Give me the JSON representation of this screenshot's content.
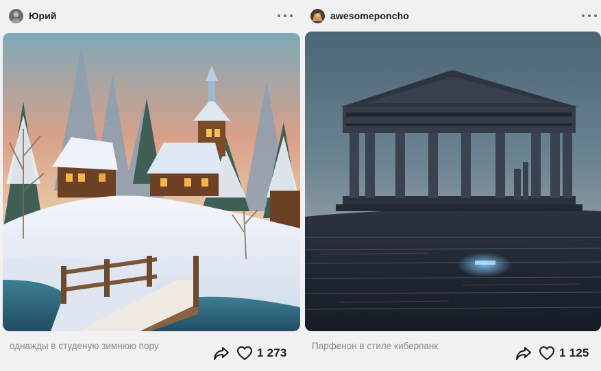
{
  "posts": [
    {
      "author": "Юрий",
      "caption": "однажды в студеную зимнюю пору",
      "likes": "1 273",
      "image_icon": "winter-village-painting"
    },
    {
      "author": "awesomeponcho",
      "caption": "Парфенон в стиле киберпанк",
      "likes": "1 125",
      "image_icon": "cyberpunk-parthenon-painting"
    }
  ],
  "icons": {
    "more": "more-horizontal-icon",
    "share": "share-icon",
    "like": "heart-icon"
  },
  "colors": {
    "background": "#f1f1f3",
    "caption": "#8a8a8f",
    "text": "#1a1a1a"
  }
}
